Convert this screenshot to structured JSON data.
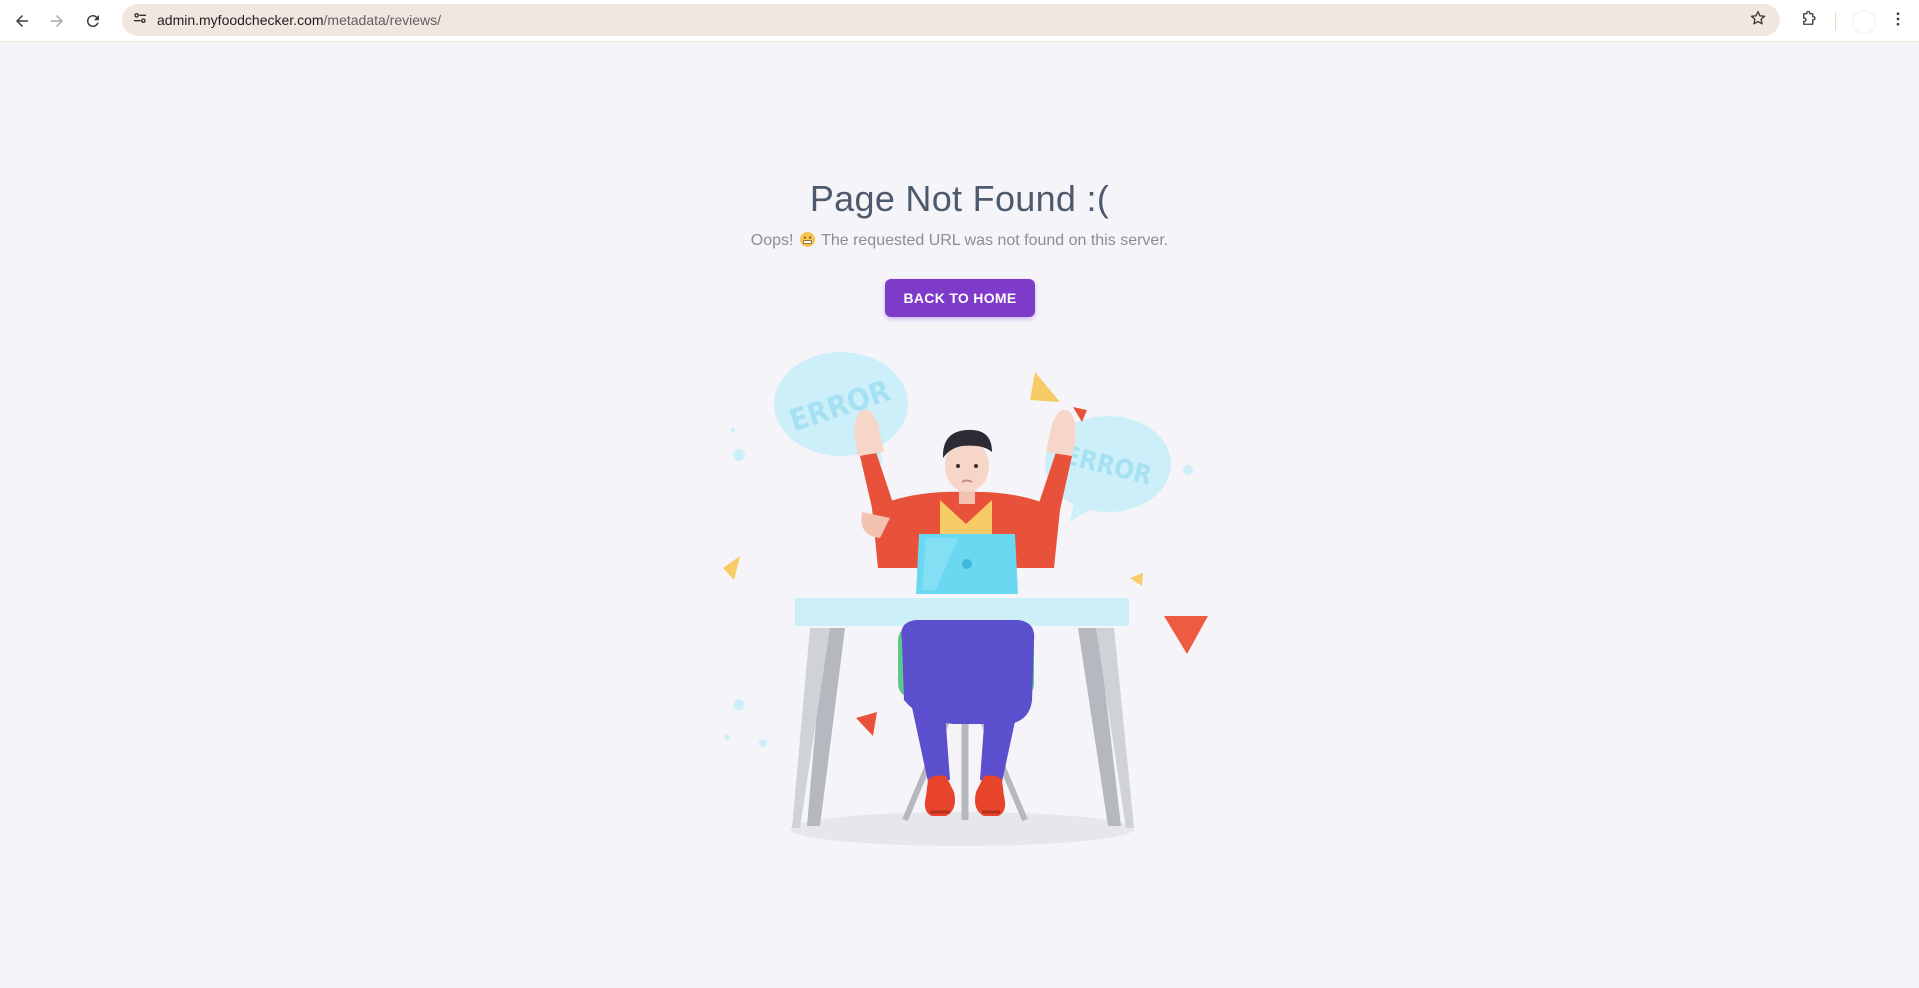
{
  "browser": {
    "url_host": "admin.myfoodchecker.com",
    "url_path": "/metadata/reviews/",
    "icons": {
      "back": "arrow-left-icon",
      "forward": "arrow-right-icon",
      "reload": "reload-icon",
      "site_info": "tune-icon",
      "bookmark": "star-icon",
      "extensions": "puzzle-icon",
      "menu": "kebab-menu-icon"
    }
  },
  "main": {
    "title": "Page Not Found :(",
    "subtitle_before": "Oops!",
    "subtitle_after": "The requested URL was not found on this server.",
    "button_label": "BACK TO HOME",
    "bubble_text_1": "ERROR",
    "bubble_text_2": "ERROR"
  },
  "colors": {
    "page_background": "#f5f5f9",
    "title": "#4d5a6e",
    "subtitle": "#8a8d93",
    "button": "#7e3ac8",
    "omnibox": "#f2e6e0"
  }
}
